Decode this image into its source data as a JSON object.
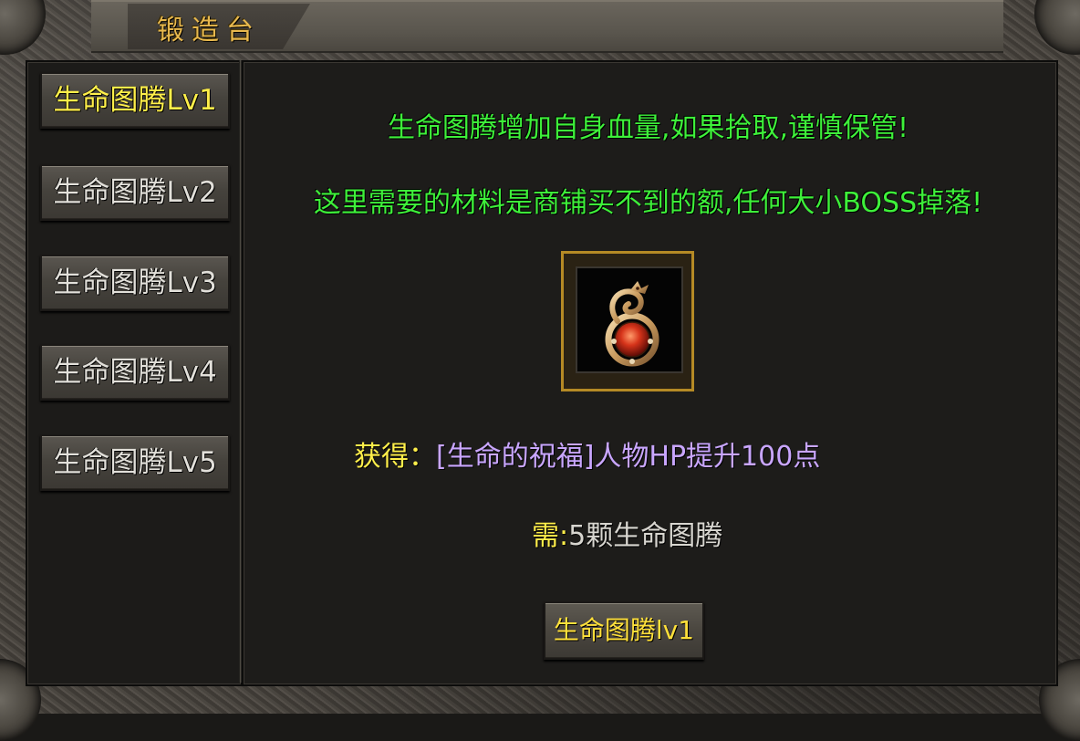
{
  "window": {
    "title": "锻造台"
  },
  "tabs": [
    {
      "label": "生命图腾Lv1",
      "active": true
    },
    {
      "label": "生命图腾Lv2",
      "active": false
    },
    {
      "label": "生命图腾Lv3",
      "active": false
    },
    {
      "label": "生命图腾Lv4",
      "active": false
    },
    {
      "label": "生命图腾Lv5",
      "active": false
    }
  ],
  "main": {
    "description_line1": "生命图腾增加自身血量,如果拾取,谨慎保管!",
    "description_line2": "这里需要的材料是商铺买不到的额,任何大小BOSS掉落!",
    "item_icon": "dragon-ruby-amulet-icon",
    "reward_label": "获得：",
    "reward_value": "[生命的祝福]人物HP提升100点",
    "requirement_label": "需:",
    "requirement_value": "5颗生命图腾",
    "forge_button_label": "生命图腾lv1"
  },
  "colors": {
    "title_gold": "#e7b84e",
    "active_tab_yellow": "#ffef4a",
    "description_green": "#3ef03a",
    "reward_purple": "#c9a6ff",
    "slot_border_gold": "#b58a25"
  }
}
